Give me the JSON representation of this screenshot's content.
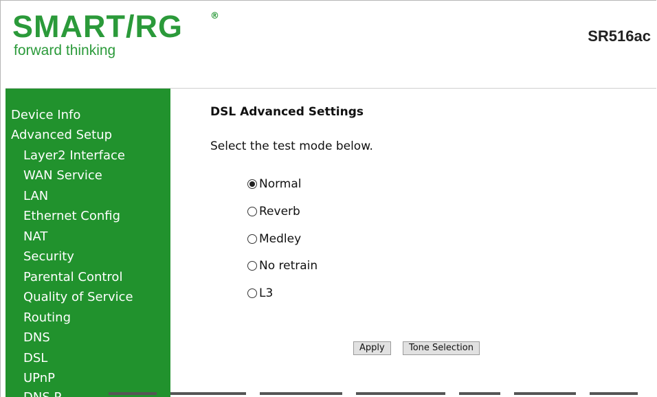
{
  "header": {
    "logo_text": "SMART/RG",
    "logo_reg": "®",
    "logo_tagline": "forward thinking",
    "model": "SR516ac"
  },
  "sidebar": {
    "items": [
      {
        "label": "Device Info",
        "level": 1
      },
      {
        "label": "Advanced Setup",
        "level": 1
      },
      {
        "label": "Layer2 Interface",
        "level": 2
      },
      {
        "label": "WAN Service",
        "level": 2
      },
      {
        "label": "LAN",
        "level": 2
      },
      {
        "label": "Ethernet Config",
        "level": 2
      },
      {
        "label": "NAT",
        "level": 2
      },
      {
        "label": "Security",
        "level": 2
      },
      {
        "label": "Parental Control",
        "level": 2
      },
      {
        "label": "Quality of Service",
        "level": 2
      },
      {
        "label": "Routing",
        "level": 2
      },
      {
        "label": "DNS",
        "level": 2
      },
      {
        "label": "DSL",
        "level": 2
      },
      {
        "label": "UPnP",
        "level": 2
      },
      {
        "label": "DNS P",
        "level": 2
      }
    ]
  },
  "main": {
    "title": "DSL Advanced Settings",
    "instruction": "Select the test mode below.",
    "test_modes": [
      {
        "label": "Normal",
        "selected": true
      },
      {
        "label": "Reverb",
        "selected": false
      },
      {
        "label": "Medley",
        "selected": false
      },
      {
        "label": "No retrain",
        "selected": false
      },
      {
        "label": "L3",
        "selected": false
      }
    ],
    "apply_label": "Apply",
    "tone_selection_label": "Tone Selection"
  },
  "colors": {
    "brand_green": "#2b9a3a",
    "sidebar_green": "#21922d"
  }
}
